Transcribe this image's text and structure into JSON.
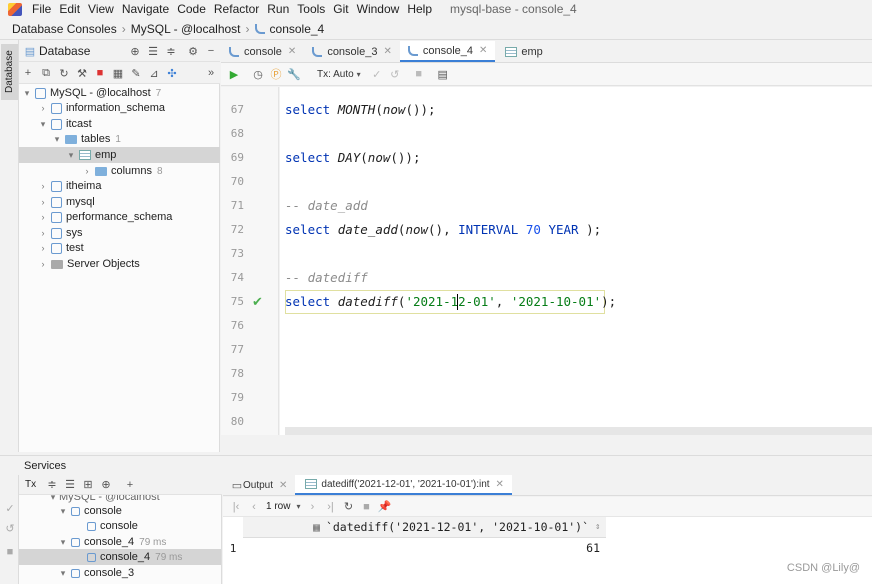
{
  "menubar": {
    "items": [
      "File",
      "Edit",
      "View",
      "Navigate",
      "Code",
      "Refactor",
      "Run",
      "Tools",
      "Git",
      "Window",
      "Help"
    ],
    "title": "mysql-base - console_4"
  },
  "breadcrumb": [
    "Database Consoles",
    "MySQL - @localhost",
    "console_4"
  ],
  "left": {
    "tab_label": "Database",
    "header": "Database",
    "tree": [
      {
        "label": "MySQL - @localhost",
        "count": "7",
        "level": 0,
        "arrow": "▾",
        "kind": "db"
      },
      {
        "label": "information_schema",
        "level": 1,
        "arrow": "›",
        "kind": "db"
      },
      {
        "label": "itcast",
        "level": 1,
        "arrow": "▾",
        "kind": "db"
      },
      {
        "label": "tables",
        "count": "1",
        "level": 2,
        "arrow": "▾",
        "kind": "folder"
      },
      {
        "label": "emp",
        "level": 3,
        "arrow": "▾",
        "kind": "table",
        "selected": true
      },
      {
        "label": "columns",
        "count": "8",
        "level": 4,
        "arrow": "›",
        "kind": "folder"
      },
      {
        "label": "itheima",
        "level": 1,
        "arrow": "›",
        "kind": "db"
      },
      {
        "label": "mysql",
        "level": 1,
        "arrow": "›",
        "kind": "db"
      },
      {
        "label": "performance_schema",
        "level": 1,
        "arrow": "›",
        "kind": "db"
      },
      {
        "label": "sys",
        "level": 1,
        "arrow": "›",
        "kind": "db"
      },
      {
        "label": "test",
        "level": 1,
        "arrow": "›",
        "kind": "db"
      },
      {
        "label": "Server Objects",
        "level": 1,
        "arrow": "›",
        "kind": "folder"
      }
    ]
  },
  "tabs": [
    {
      "label": "console"
    },
    {
      "label": "console_3"
    },
    {
      "label": "console_4",
      "active": true
    },
    {
      "label": "emp"
    }
  ],
  "editor_toolbar": {
    "tx": "Tx: Auto"
  },
  "editor": {
    "lines": [
      {
        "n": "67",
        "html": "select MONTH(now());"
      },
      {
        "n": "68",
        "html": ""
      },
      {
        "n": "69",
        "html": "select DAY(now());"
      },
      {
        "n": "70",
        "html": ""
      },
      {
        "n": "71",
        "html": "-- date_add"
      },
      {
        "n": "72",
        "html": "select date_add(now(), INTERVAL 70 YEAR );"
      },
      {
        "n": "73",
        "html": ""
      },
      {
        "n": "74",
        "html": "-- datediff"
      },
      {
        "n": "75",
        "html": "select datediff('2021-12-01', '2021-10-01');"
      },
      {
        "n": "76",
        "html": ""
      },
      {
        "n": "77",
        "html": ""
      },
      {
        "n": "78",
        "html": ""
      },
      {
        "n": "79",
        "html": ""
      },
      {
        "n": "80",
        "html": ""
      }
    ]
  },
  "services": {
    "title": "Services",
    "tx": "Tx",
    "tree": [
      {
        "label": "MySQL - @localhost",
        "level": 1,
        "arrow": "▾"
      },
      {
        "label": "console",
        "level": 2,
        "arrow": "▾"
      },
      {
        "label": "console",
        "level": 3,
        "arrow": ""
      },
      {
        "label": "console_4",
        "time": "79 ms",
        "level": 2,
        "arrow": "▾"
      },
      {
        "label": "console_4",
        "time": "79 ms",
        "level": 3,
        "arrow": "",
        "selected": true
      },
      {
        "label": "console_3",
        "level": 2,
        "arrow": "▾"
      }
    ]
  },
  "output": {
    "tabs": [
      "Output",
      "datediff('2021-12-01', '2021-10-01'):int"
    ],
    "rows_label": "1 row",
    "column": "`datediff('2021-12-01', '2021-10-01')`",
    "row_num": "1",
    "value": "61"
  },
  "watermark": "CSDN @Lily@"
}
